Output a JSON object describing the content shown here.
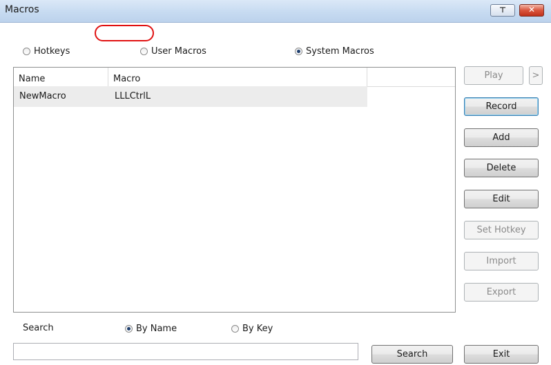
{
  "window": {
    "title": "Macros",
    "pin_glyph": "⊤",
    "close_glyph": "✕"
  },
  "macro_type": {
    "options": [
      {
        "label": "Hotkeys",
        "selected": false
      },
      {
        "label": "User Macros",
        "selected": false
      },
      {
        "label": "System Macros",
        "selected": true
      }
    ]
  },
  "table": {
    "columns": [
      "Name",
      "Macro"
    ],
    "rows": [
      {
        "name": "NewMacro",
        "macro": "LLLCtrlL"
      }
    ],
    "highlight_color": "#e01010"
  },
  "buttons": {
    "play": "Play",
    "play_more": ">",
    "record": "Record",
    "add": "Add",
    "delete": "Delete",
    "edit": "Edit",
    "set_hotkey": "Set Hotkey",
    "import": "Import",
    "export": "Export",
    "search": "Search",
    "exit": "Exit"
  },
  "search": {
    "label": "Search",
    "value": "",
    "options": [
      {
        "label": "By Name",
        "selected": true
      },
      {
        "label": "By Key",
        "selected": false
      }
    ]
  }
}
